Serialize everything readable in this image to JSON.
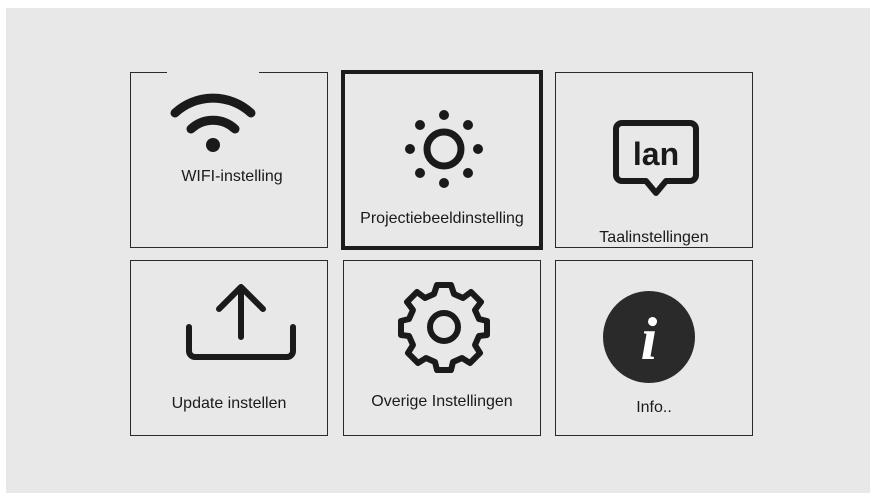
{
  "menu": {
    "tiles": [
      {
        "label": "WIFI-instelling",
        "icon": "wifi-icon",
        "selected": false
      },
      {
        "label": "Projectiebeeldinstelling",
        "icon": "brightness-icon",
        "selected": true
      },
      {
        "label": "Taalinstellingen",
        "icon": "language-icon",
        "selected": false
      },
      {
        "label": "Update instellen",
        "icon": "upload-icon",
        "selected": false
      },
      {
        "label": "Overige Instellingen",
        "icon": "gear-icon",
        "selected": false
      },
      {
        "label": "Info..",
        "icon": "info-icon",
        "selected": false
      }
    ],
    "language_icon_text": "lan",
    "info_icon_text": "i"
  },
  "colors": {
    "background": "#e8e8e8",
    "border": "#2a2a2a",
    "icon": "#1a1a1a"
  }
}
